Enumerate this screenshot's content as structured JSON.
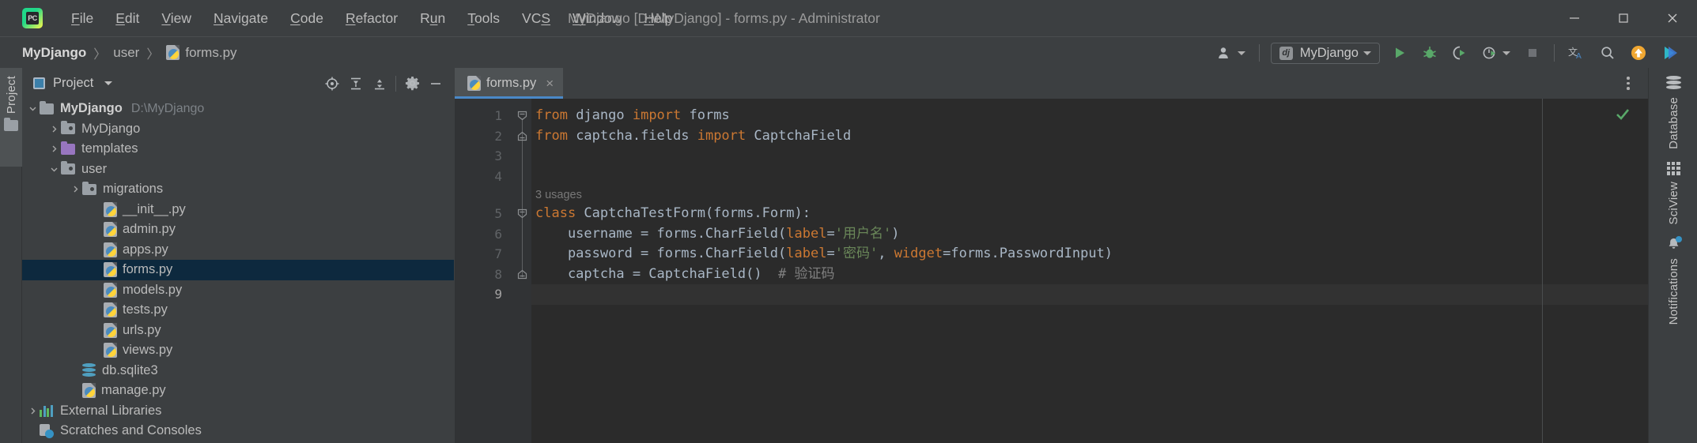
{
  "window": {
    "title": "MyDjango [D:\\MyDjango] - forms.py - Administrator",
    "logo_text": "PC",
    "controls": {
      "minimize": "minimize-icon",
      "maximize": "maximize-icon",
      "close": "close-icon"
    }
  },
  "menubar": {
    "items": [
      {
        "label": "File",
        "mnemonic": "F"
      },
      {
        "label": "Edit",
        "mnemonic": "E"
      },
      {
        "label": "View",
        "mnemonic": "V"
      },
      {
        "label": "Navigate",
        "mnemonic": "N"
      },
      {
        "label": "Code",
        "mnemonic": "C"
      },
      {
        "label": "Refactor",
        "mnemonic": "R"
      },
      {
        "label": "Run",
        "mnemonic": "u"
      },
      {
        "label": "Tools",
        "mnemonic": "T"
      },
      {
        "label": "VCS",
        "mnemonic": "S"
      },
      {
        "label": "Window",
        "mnemonic": "W"
      },
      {
        "label": "Help",
        "mnemonic": "H"
      }
    ]
  },
  "breadcrumb": {
    "items": [
      "MyDjango",
      "user",
      "forms.py"
    ],
    "separator": "〉"
  },
  "toolbar": {
    "run_config": "MyDjango",
    "buttons": [
      "user-account-icon",
      "run-configuration-selector",
      "run-button",
      "debug-button",
      "run-with-coverage-button",
      "profile-button",
      "stop-button",
      "translate-button",
      "search-everywhere-button",
      "update-project-button",
      "ide-assistant-button"
    ]
  },
  "left_strip": {
    "project_tab": "Project"
  },
  "project_panel": {
    "title": "Project",
    "toolbar_icons": [
      "locate-icon",
      "expand-all-icon",
      "collapse-all-icon",
      "settings-gear-icon",
      "hide-panel-icon"
    ],
    "tree": [
      {
        "label": "MyDjango",
        "sublabel": "D:\\MyDjango",
        "indent": 0,
        "arrow": "down",
        "icon": "folder",
        "bold": true,
        "selected": false
      },
      {
        "label": "MyDjango",
        "sublabel": "",
        "indent": 1,
        "arrow": "right",
        "icon": "folder-module",
        "bold": false,
        "selected": false
      },
      {
        "label": "templates",
        "sublabel": "",
        "indent": 1,
        "arrow": "right",
        "icon": "folder-purple",
        "bold": false,
        "selected": false
      },
      {
        "label": "user",
        "sublabel": "",
        "indent": 1,
        "arrow": "down",
        "icon": "folder-module",
        "bold": false,
        "selected": false
      },
      {
        "label": "migrations",
        "sublabel": "",
        "indent": 2,
        "arrow": "right",
        "icon": "folder-module",
        "bold": false,
        "selected": false
      },
      {
        "label": "__init__.py",
        "sublabel": "",
        "indent": 3,
        "arrow": "none",
        "icon": "python-file",
        "bold": false,
        "selected": false
      },
      {
        "label": "admin.py",
        "sublabel": "",
        "indent": 3,
        "arrow": "none",
        "icon": "python-file",
        "bold": false,
        "selected": false
      },
      {
        "label": "apps.py",
        "sublabel": "",
        "indent": 3,
        "arrow": "none",
        "icon": "python-file",
        "bold": false,
        "selected": false
      },
      {
        "label": "forms.py",
        "sublabel": "",
        "indent": 3,
        "arrow": "none",
        "icon": "python-file",
        "bold": false,
        "selected": true
      },
      {
        "label": "models.py",
        "sublabel": "",
        "indent": 3,
        "arrow": "none",
        "icon": "python-file",
        "bold": false,
        "selected": false
      },
      {
        "label": "tests.py",
        "sublabel": "",
        "indent": 3,
        "arrow": "none",
        "icon": "python-file",
        "bold": false,
        "selected": false
      },
      {
        "label": "urls.py",
        "sublabel": "",
        "indent": 3,
        "arrow": "none",
        "icon": "python-file",
        "bold": false,
        "selected": false
      },
      {
        "label": "views.py",
        "sublabel": "",
        "indent": 3,
        "arrow": "none",
        "icon": "python-file",
        "bold": false,
        "selected": false
      },
      {
        "label": "db.sqlite3",
        "sublabel": "",
        "indent": 2,
        "arrow": "none",
        "icon": "database-file",
        "bold": false,
        "selected": false
      },
      {
        "label": "manage.py",
        "sublabel": "",
        "indent": 2,
        "arrow": "none",
        "icon": "python-file",
        "bold": false,
        "selected": false
      },
      {
        "label": "External Libraries",
        "sublabel": "",
        "indent": 0,
        "arrow": "right",
        "icon": "libraries",
        "bold": false,
        "selected": false
      },
      {
        "label": "Scratches and Consoles",
        "sublabel": "",
        "indent": 0,
        "arrow": "none",
        "icon": "scratches",
        "bold": false,
        "selected": false
      }
    ]
  },
  "editor": {
    "tab": {
      "label": "forms.py",
      "close": "×",
      "icon": "python-file"
    },
    "overflow_menu": "more-options-icon",
    "inspection_status": "ok",
    "usages_hint": "3 usages",
    "current_line": 9,
    "lines": [
      {
        "n": 1,
        "tokens": [
          {
            "t": "from",
            "c": "k"
          },
          {
            "t": " django ",
            "c": "p"
          },
          {
            "t": "import",
            "c": "k"
          },
          {
            "t": " forms",
            "c": "p"
          }
        ]
      },
      {
        "n": 2,
        "tokens": [
          {
            "t": "from",
            "c": "k"
          },
          {
            "t": " captcha.fields ",
            "c": "p"
          },
          {
            "t": "import",
            "c": "k"
          },
          {
            "t": " CaptchaField",
            "c": "p"
          }
        ]
      },
      {
        "n": 3,
        "tokens": []
      },
      {
        "n": 4,
        "tokens": []
      },
      {
        "n": 5,
        "tokens": [
          {
            "t": "class",
            "c": "k"
          },
          {
            "t": " CaptchaTestForm(forms.Form):",
            "c": "p"
          }
        ]
      },
      {
        "n": 6,
        "tokens": [
          {
            "t": "    username = forms.CharField(",
            "c": "p"
          },
          {
            "t": "label",
            "c": "k"
          },
          {
            "t": "=",
            "c": "p"
          },
          {
            "t": "'用户名'",
            "c": "s"
          },
          {
            "t": ")",
            "c": "p"
          }
        ]
      },
      {
        "n": 7,
        "tokens": [
          {
            "t": "    password = forms.CharField(",
            "c": "p"
          },
          {
            "t": "label",
            "c": "k"
          },
          {
            "t": "=",
            "c": "p"
          },
          {
            "t": "'密码'",
            "c": "s"
          },
          {
            "t": ", ",
            "c": "p"
          },
          {
            "t": "widget",
            "c": "k"
          },
          {
            "t": "=forms.PasswordInput)",
            "c": "p"
          }
        ]
      },
      {
        "n": 8,
        "tokens": [
          {
            "t": "    captcha = CaptchaField()  ",
            "c": "p"
          },
          {
            "t": "# 验证码",
            "c": "cm"
          }
        ]
      },
      {
        "n": 9,
        "tokens": []
      }
    ]
  },
  "right_strip": {
    "items": [
      {
        "label": "Database",
        "icon": "database-icon"
      },
      {
        "label": "SciView",
        "icon": "grid-icon"
      },
      {
        "label": "Notifications",
        "icon": "bell-icon"
      }
    ]
  },
  "colors": {
    "keyword": "#cc7832",
    "string": "#6a8759",
    "plain": "#a9b7c6",
    "comment": "#808080",
    "accent": "#4a88c7",
    "selection": "#0d293e",
    "panel_bg": "#3c3f41",
    "editor_bg": "#2b2b2b"
  }
}
